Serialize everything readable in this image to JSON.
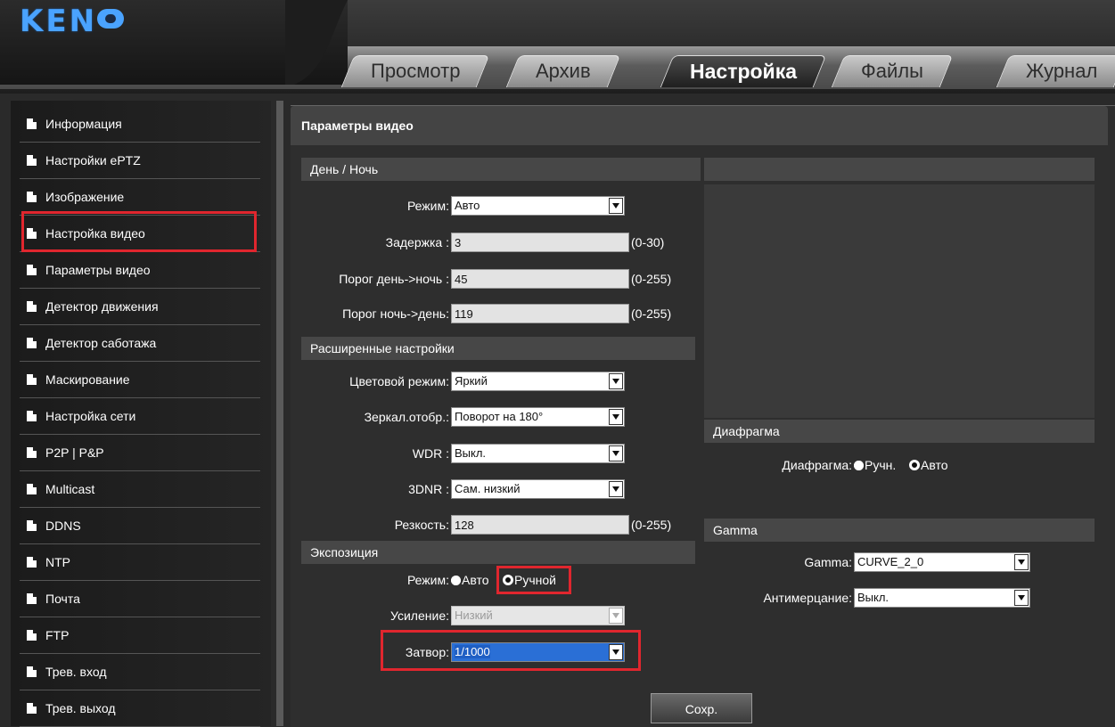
{
  "brand": {
    "logo_text": "KEN"
  },
  "tabs": [
    {
      "label": "Просмотр"
    },
    {
      "label": "Архив"
    },
    {
      "label": "Настройка"
    },
    {
      "label": "Файлы"
    },
    {
      "label": "Журнал"
    }
  ],
  "sidebar": {
    "items": [
      {
        "label": "Информация"
      },
      {
        "label": "Настройки ePTZ"
      },
      {
        "label": "Изображение"
      },
      {
        "label": "Настройка видео"
      },
      {
        "label": "Параметры видео"
      },
      {
        "label": "Детектор движения"
      },
      {
        "label": "Детектор саботажа"
      },
      {
        "label": "Маскирование"
      },
      {
        "label": "Настройка сети"
      },
      {
        "label": "P2P | P&P"
      },
      {
        "label": "Multicast"
      },
      {
        "label": "DDNS"
      },
      {
        "label": "NTP"
      },
      {
        "label": "Почта"
      },
      {
        "label": "FTP"
      },
      {
        "label": "Трев. вход"
      },
      {
        "label": "Трев. выход"
      }
    ]
  },
  "main": {
    "title": "Параметры видео",
    "daynight": {
      "section": "День / Ночь",
      "mode_label": "Режим:",
      "mode_value": "Авто",
      "delay_label": "Задержка :",
      "delay_value": "3",
      "delay_range": "(0-30)",
      "d2n_label": "Порог день->ночь :",
      "d2n_value": "45",
      "d2n_range": "(0-255)",
      "n2d_label": "Порог ночь->день:",
      "n2d_value": "119",
      "n2d_range": "(0-255)"
    },
    "advanced": {
      "section": "Расширенные настройки",
      "color_label": "Цветовой режим:",
      "color_value": "Яркий",
      "mirror_label": "Зеркал.отобр.:",
      "mirror_value": "Поворот на 180°",
      "wdr_label": "WDR :",
      "wdr_value": "Выкл.",
      "dnr_label": "3DNR :",
      "dnr_value": "Сам. низкий",
      "sharp_label": "Резкость:",
      "sharp_value": "128",
      "sharp_range": "(0-255)"
    },
    "exposure": {
      "section": "Экспозиция",
      "mode_label": "Режим:",
      "auto_label": "Авто",
      "manual_label": "Ручной",
      "gain_label": "Усиление:",
      "gain_value": "Низкий",
      "shutter_label": "Затвор:",
      "shutter_value": "1/1000"
    },
    "iris": {
      "section": "Диафрагма",
      "label": "Диафрагма:",
      "manual_label": "Ручн.",
      "auto_label": "Авто"
    },
    "gamma": {
      "section": "Gamma",
      "gamma_label": "Gamma:",
      "gamma_value": "CURVE_2_0",
      "flicker_label": "Антимерцание:",
      "flicker_value": "Выкл."
    },
    "save_label": "Сохр."
  },
  "colors": {
    "highlight": "#e0262e",
    "logo": "#4aa3ff",
    "selected": "#2a6fd6"
  }
}
